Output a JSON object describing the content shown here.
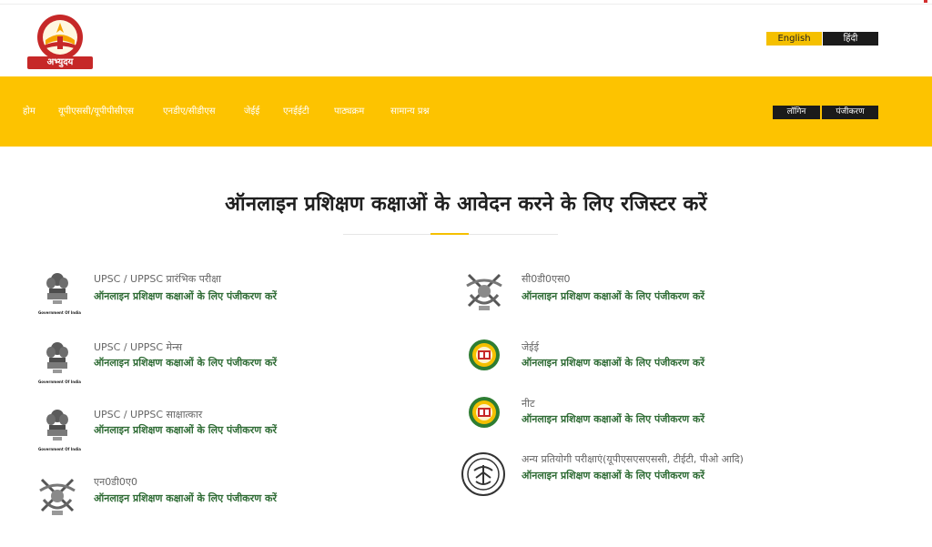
{
  "header": {
    "logo_text": "अभ्युदय",
    "lang": {
      "english": "English",
      "hindi": "हिंदी"
    }
  },
  "nav": {
    "items": [
      "होम",
      "यूपीएससी/यूपीपीसीएस",
      "एनडीए/सीडीएस",
      "जेईई",
      "एनईईटी",
      "पाठ्यक्रम",
      "सामान्य प्रश्न"
    ],
    "login": "लॉगिन",
    "register": "पंजीकरण"
  },
  "main": {
    "heading": "ऑनलाइन प्रशिक्षण कक्षाओं के आवेदन करने के लिए रजिस्टर करें",
    "courses_left": [
      {
        "title": "UPSC / UPPSC प्रारंभिक परीक्षा",
        "link": "ऑनलाइन प्रशिक्षण कक्षाओं के लिए पंजीकरण करें",
        "icon": "emblem-icon",
        "icon_caption": "Government Of India"
      },
      {
        "title": "UPSC / UPPSC मेन्स",
        "link": "ऑनलाइन प्रशिक्षण कक्षाओं के लिए पंजीकरण करें",
        "icon": "emblem-icon",
        "icon_caption": "Government Of India"
      },
      {
        "title": "UPSC / UPPSC साक्षात्कार",
        "link": "ऑनलाइन प्रशिक्षण कक्षाओं के लिए पंजीकरण करें",
        "icon": "emblem-icon",
        "icon_caption": "Government Of India"
      },
      {
        "title": "एन0डी0ए0",
        "link": "ऑनलाइन प्रशिक्षण कक्षाओं के लिए पंजीकरण करें",
        "icon": "military-emblem-icon"
      }
    ],
    "courses_right": [
      {
        "title": "सी0डी0एस0",
        "link": "ऑनलाइन प्रशिक्षण कक्षाओं के लिए पंजीकरण करें",
        "icon": "military-emblem-icon"
      },
      {
        "title": "जेईई",
        "link": "ऑनलाइन प्रशिक्षण कक्षाओं के लिए पंजीकरण करें",
        "icon": "exam-badge-icon"
      },
      {
        "title": "नीट",
        "link": "ऑनलाइन प्रशिक्षण कक्षाओं के लिए पंजीकरण करें",
        "icon": "exam-badge-icon"
      },
      {
        "title": "अन्य प्रतियोगी परीक्षाएं(यूपीएसएसएससी, टीईटी, पीओ आदि)",
        "link": "ऑनलाइन प्रशिक्षण कक्षाओं के लिए पंजीकरण करें",
        "icon": "up-seal-icon"
      }
    ]
  },
  "colors": {
    "accent": "#fdc300",
    "dark": "#1b1b1b",
    "link": "#2e6b34",
    "logo_red": "#c62828"
  }
}
